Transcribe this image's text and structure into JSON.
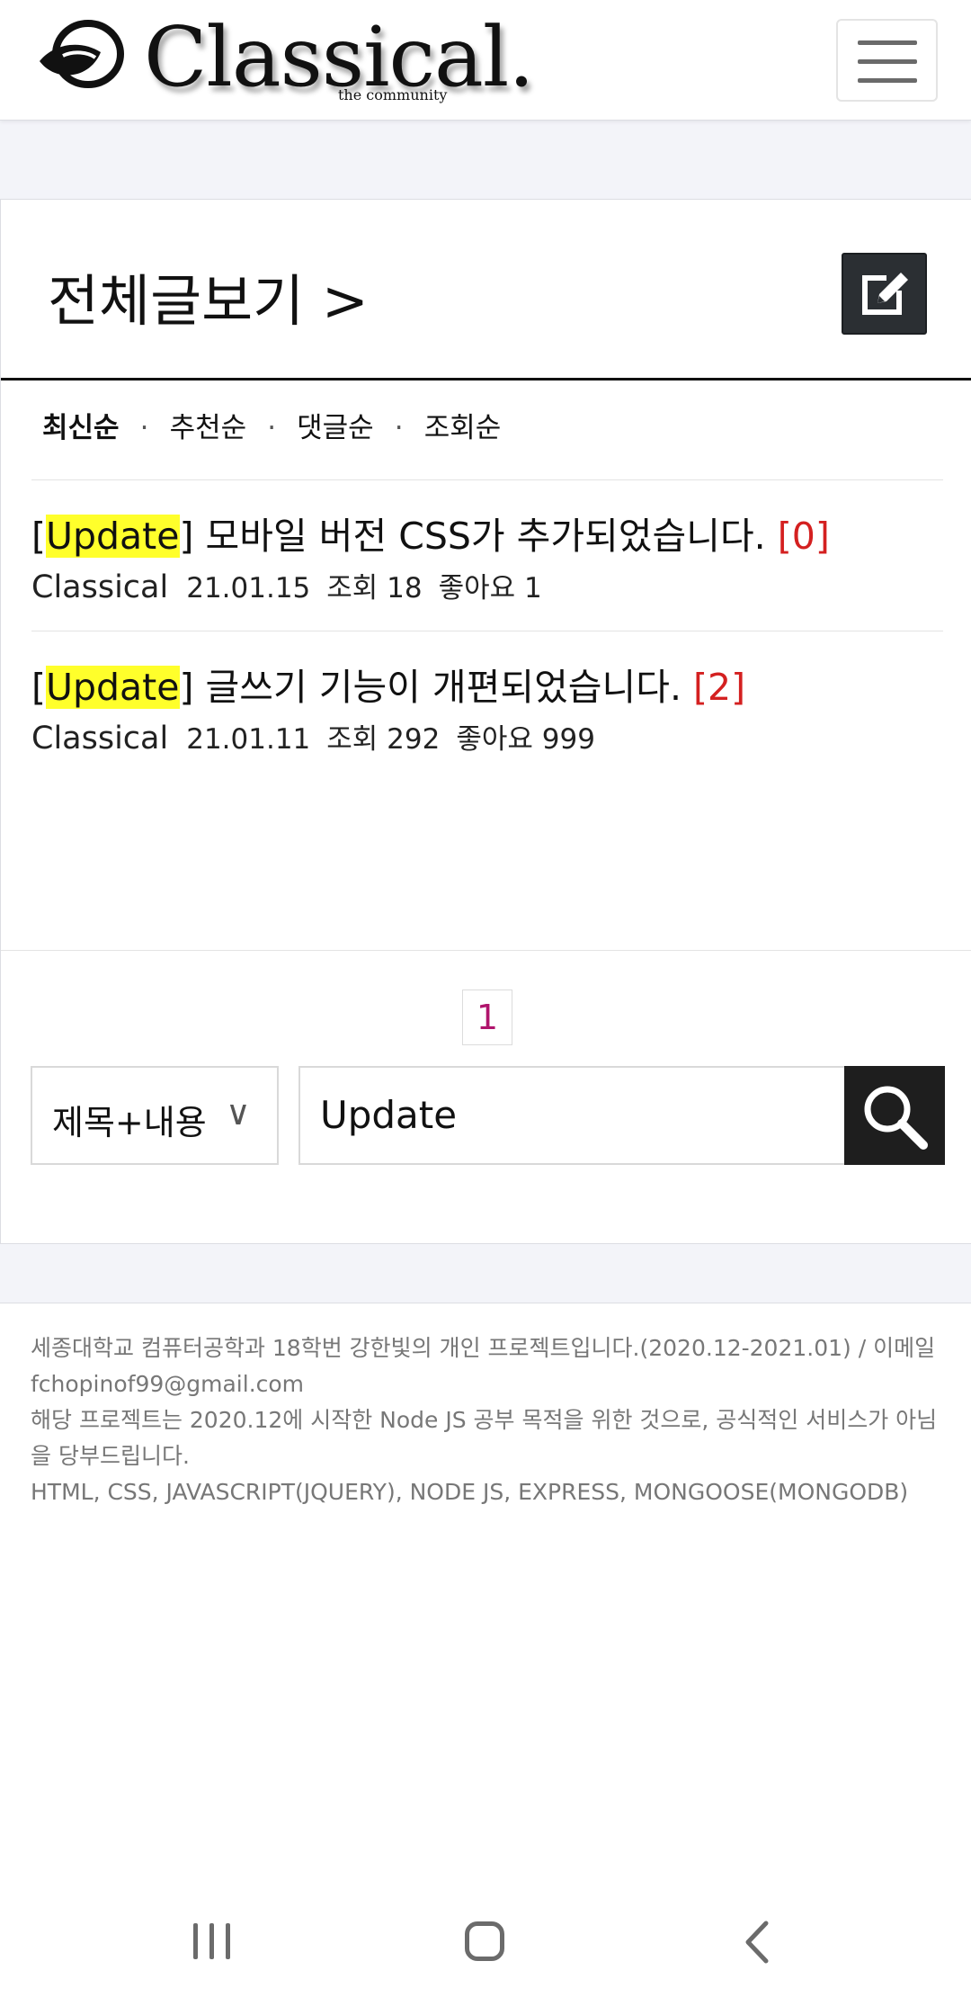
{
  "header": {
    "logo_text": "Classical.",
    "logo_subtitle": "the community",
    "logo_icon": "classical-logo-mark",
    "menu_icon": "hamburger-menu-icon"
  },
  "board": {
    "title": "전체글보기 >",
    "write_icon": "edit-icon",
    "sort_options": [
      {
        "label": "최신순",
        "active": true
      },
      {
        "label": "추천순",
        "active": false
      },
      {
        "label": "댓글순",
        "active": false
      },
      {
        "label": "조회순",
        "active": false
      }
    ],
    "sort_separator": "·",
    "posts": [
      {
        "bracket_open": "[",
        "tag": "Update",
        "bracket_close": "]",
        "title": " 모바일 버전 CSS가 추가되었습니다. ",
        "comment_count": "[0]",
        "author": "Classical",
        "date": "21.01.15",
        "views": "조회 18",
        "likes": "좋아요 1"
      },
      {
        "bracket_open": "[",
        "tag": "Update",
        "bracket_close": "]",
        "title": " 글쓰기 기능이 개편되었습니다. ",
        "comment_count": "[2]",
        "author": "Classical",
        "date": "21.01.11",
        "views": "조회 292",
        "likes": "좋아요 999"
      }
    ]
  },
  "pagination": {
    "current_page": "1"
  },
  "search": {
    "scope_label": "제목+내용",
    "scope_chevron": "∨",
    "query": "Update",
    "button_icon": "search-icon"
  },
  "footer": {
    "lines": [
      "세종대학교 컴퓨터공학과 18학번 강한빛의 개인 프로젝트입니다.(2020.12-2021.01) / 이메일 fchopinof99@gmail.com",
      "해당 프로젝트는 2020.12에 시작한 Node JS 공부 목적을 위한 것으로, 공식적인 서비스가 아님을 당부드립니다.",
      "HTML, CSS, JAVASCRIPT(JQUERY), NODE JS, EXPRESS, MONGOOSE(MONGODB)"
    ]
  },
  "system_nav": {
    "recents_icon": "recents-icon",
    "home_icon": "home-icon",
    "back_icon": "back-icon"
  }
}
